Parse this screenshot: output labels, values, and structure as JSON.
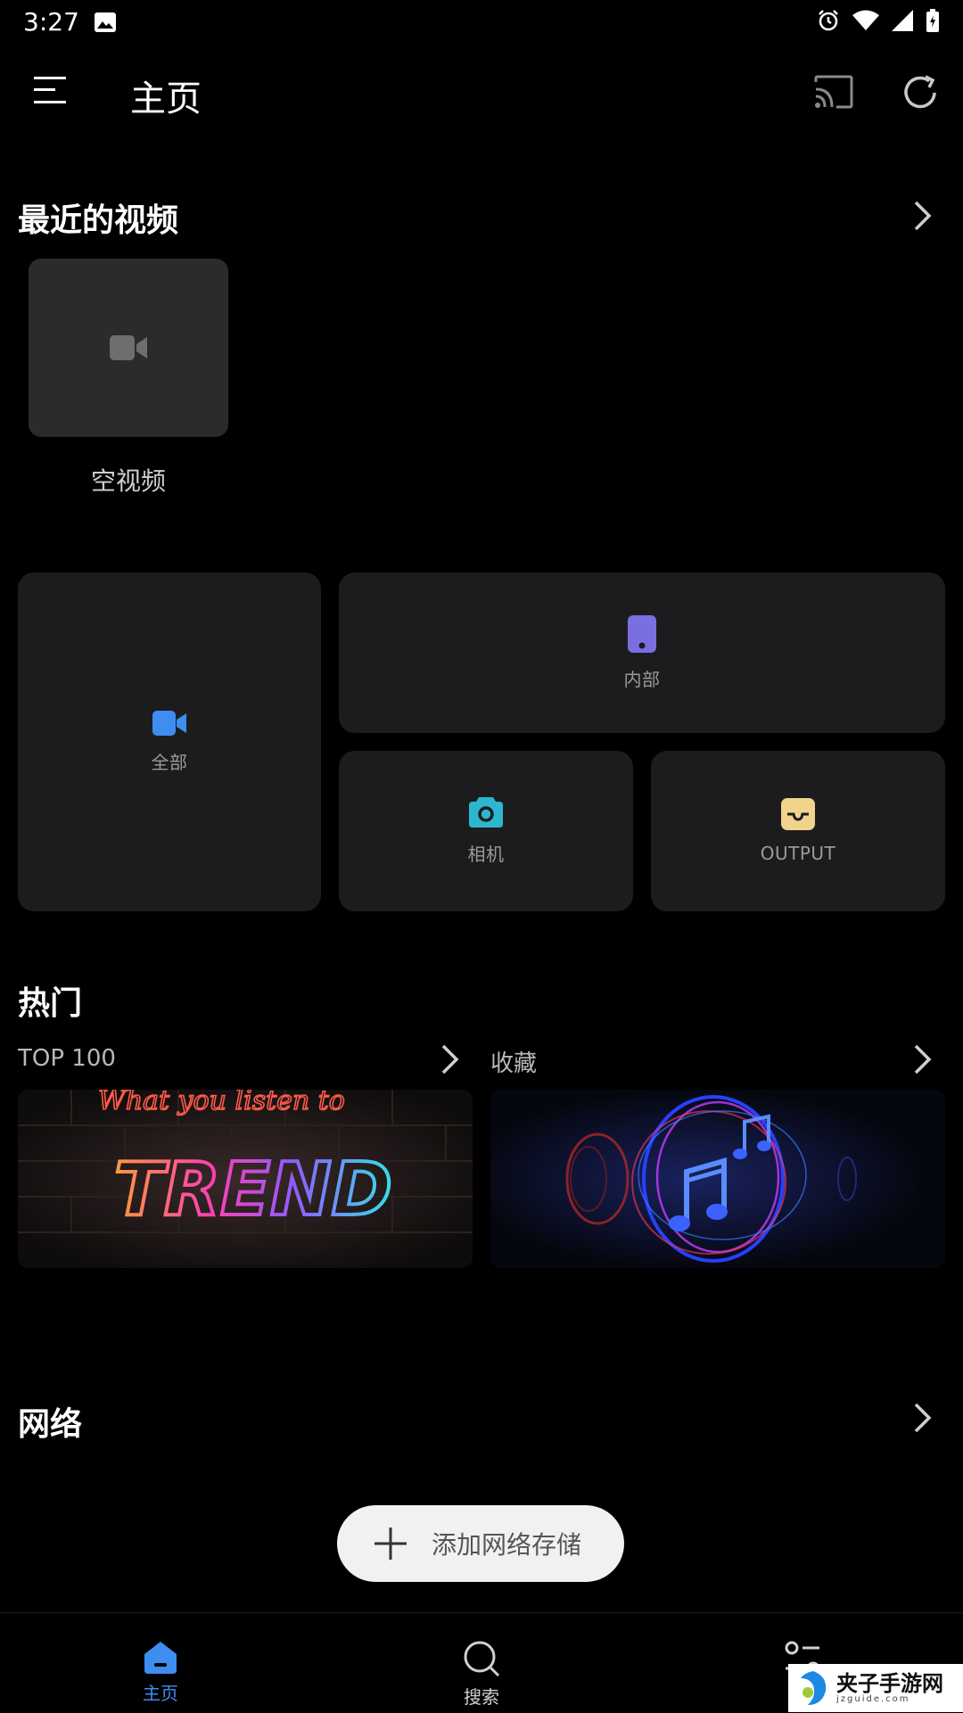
{
  "status_bar": {
    "time": "3:27"
  },
  "app_bar": {
    "title": "主页"
  },
  "recent": {
    "title": "最近的视频",
    "items": [
      {
        "label": "空视频"
      }
    ]
  },
  "folders": [
    {
      "label": "全部",
      "icon": "video-camera-icon",
      "color": "#3d8ef0"
    },
    {
      "label": "内部",
      "icon": "phone-storage-icon",
      "color": "#7a6fe0"
    },
    {
      "label": "相机",
      "icon": "camera-icon",
      "color": "#2bb7cf"
    },
    {
      "label": "OUTPUT",
      "icon": "tray-folder-icon",
      "color": "#f1d38c"
    }
  ],
  "popular": {
    "title": "热门",
    "lists": [
      {
        "label": "TOP 100",
        "banner_top_text": "What you listen to",
        "banner_text": "TREND"
      },
      {
        "label": "收藏"
      }
    ]
  },
  "network": {
    "title": "网络",
    "add_button": "添加网络存储"
  },
  "bottom_nav": {
    "items": [
      {
        "label": "主页",
        "active": true
      },
      {
        "label": "搜索",
        "active": false
      }
    ],
    "active_color": "#3d8ef0"
  },
  "watermark": {
    "title": "夹子手游网",
    "subtitle": "jzguide.com"
  }
}
